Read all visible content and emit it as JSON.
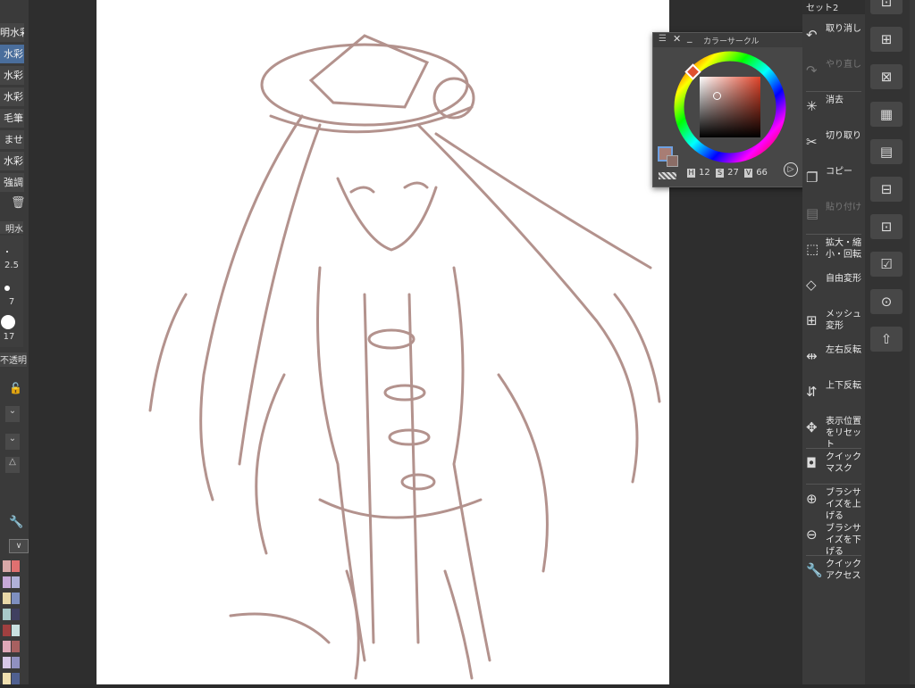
{
  "app": {
    "set_title": "セット2"
  },
  "brushes": {
    "items": [
      "明水彩",
      "水彩",
      "水彩",
      "水彩",
      "毛筆",
      "ませ",
      "水彩",
      "強調"
    ],
    "selected_index": 1
  },
  "brush_sizes": {
    "header": "明水彩",
    "values": [
      "2.5",
      "7",
      "17"
    ]
  },
  "opacity_label": "不透明",
  "color_circle": {
    "title": "カラーサークル",
    "h_label": "H",
    "h_value": "12",
    "s_label": "S",
    "s_value": "27",
    "v_label": "V",
    "v_value": "66",
    "main_color": "#a87d74",
    "sub_color": "#8b6d66"
  },
  "commands": [
    {
      "label": "取り消し",
      "icon": "undo-icon",
      "enabled": true
    },
    {
      "label": "やり直し",
      "icon": "redo-icon",
      "enabled": false
    },
    {
      "label": "消去",
      "icon": "clear-icon",
      "enabled": true
    },
    {
      "label": "切り取り",
      "icon": "scissors-icon",
      "enabled": true
    },
    {
      "label": "コピー",
      "icon": "copy-icon",
      "enabled": true
    },
    {
      "label": "貼り付け",
      "icon": "paste-icon",
      "enabled": false
    },
    {
      "label": "拡大・縮小・回転",
      "icon": "scale-rotate-icon",
      "enabled": true
    },
    {
      "label": "自由変形",
      "icon": "free-transform-icon",
      "enabled": true
    },
    {
      "label": "メッシュ変形",
      "icon": "mesh-transform-icon",
      "enabled": true
    },
    {
      "label": "左右反転",
      "icon": "flip-horizontal-icon",
      "enabled": true
    },
    {
      "label": "上下反転",
      "icon": "flip-vertical-icon",
      "enabled": true
    },
    {
      "label": "表示位置をリセット",
      "icon": "reset-view-icon",
      "enabled": true
    },
    {
      "label": "クイックマスク",
      "icon": "quick-mask-icon",
      "enabled": true
    },
    {
      "label": "ブラシサイズを上げる",
      "icon": "brush-size-up-icon",
      "enabled": true
    },
    {
      "label": "ブラシサイズを下げる",
      "icon": "brush-size-down-icon",
      "enabled": true
    },
    {
      "label": "クイックアクセス",
      "icon": "wrench-icon",
      "enabled": true
    }
  ],
  "palette_colors": [
    "#d9a8a8",
    "#e07070",
    "#c7a8d8",
    "#b0b0d8",
    "#e8d8a8",
    "#7e8fbf",
    "#a8c8c8",
    "#404060",
    "#a04040",
    "#c8e0e0",
    "#e0a8b8",
    "#a86060",
    "#d8c8e8",
    "#9090c0",
    "#f0e0b0",
    "#506090"
  ]
}
